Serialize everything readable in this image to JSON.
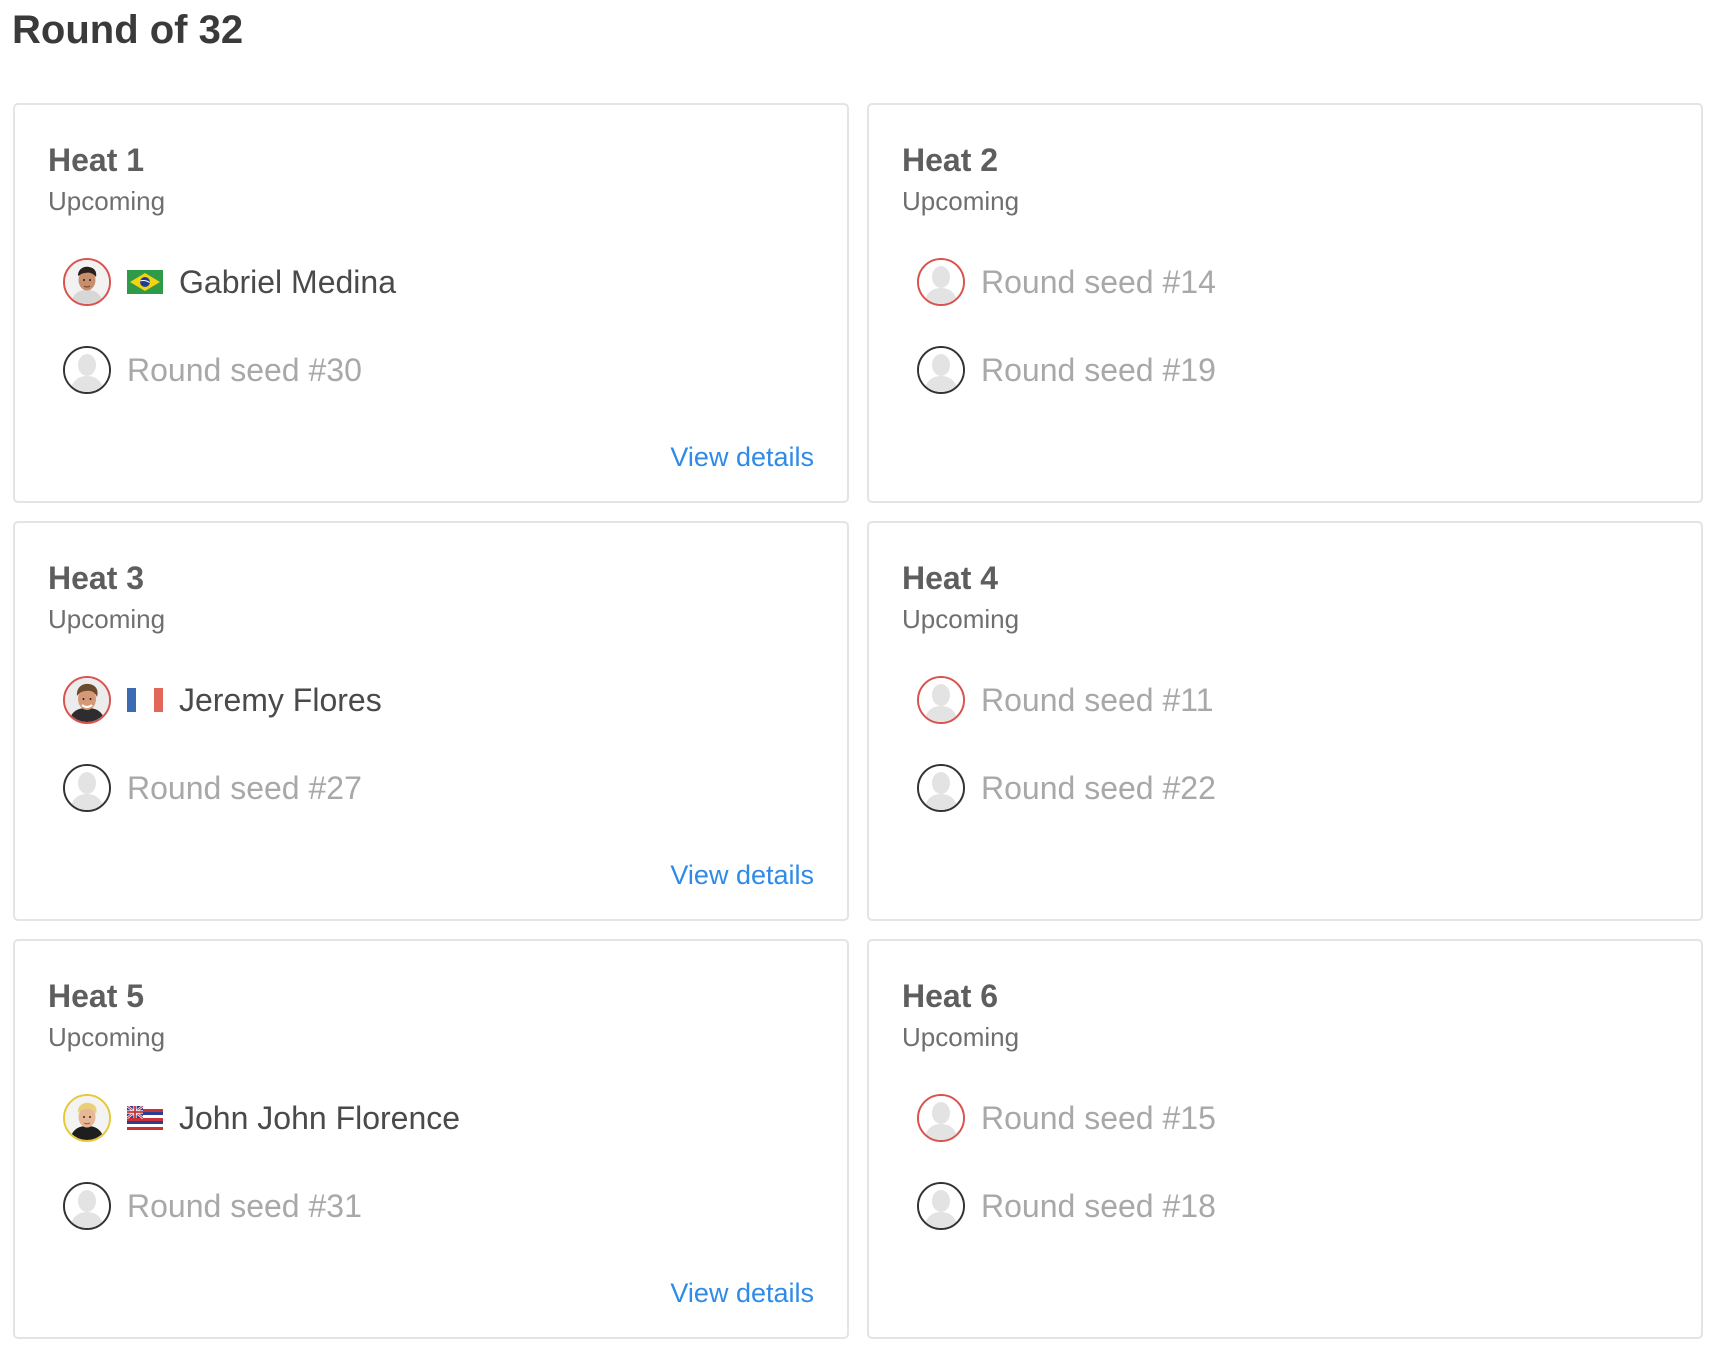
{
  "page": {
    "title": "Round of 32"
  },
  "colors": {
    "accent_link": "#2f8ae8",
    "ring_red": "#d9534f",
    "ring_dark": "#333333",
    "ring_gold": "#e5c93a"
  },
  "heats": [
    {
      "title": "Heat 1",
      "status": "Upcoming",
      "athletes": [
        {
          "name": "Gabriel Medina",
          "flag": "brazil-flag-icon",
          "ring": "#d9534f",
          "kind": "surfer"
        },
        {
          "name": "Round seed #30",
          "flag": null,
          "ring": "#333333",
          "kind": "seed"
        }
      ],
      "link": "View details"
    },
    {
      "title": "Heat 2",
      "status": "Upcoming",
      "athletes": [
        {
          "name": "Round seed #14",
          "flag": null,
          "ring": "#d9534f",
          "kind": "seed"
        },
        {
          "name": "Round seed #19",
          "flag": null,
          "ring": "#333333",
          "kind": "seed"
        }
      ],
      "link": null
    },
    {
      "title": "Heat 3",
      "status": "Upcoming",
      "athletes": [
        {
          "name": "Jeremy Flores",
          "flag": "france-flag-icon",
          "ring": "#d9534f",
          "kind": "surfer"
        },
        {
          "name": "Round seed #27",
          "flag": null,
          "ring": "#333333",
          "kind": "seed"
        }
      ],
      "link": "View details"
    },
    {
      "title": "Heat 4",
      "status": "Upcoming",
      "athletes": [
        {
          "name": "Round seed #11",
          "flag": null,
          "ring": "#d9534f",
          "kind": "seed"
        },
        {
          "name": "Round seed #22",
          "flag": null,
          "ring": "#333333",
          "kind": "seed"
        }
      ],
      "link": null
    },
    {
      "title": "Heat 5",
      "status": "Upcoming",
      "athletes": [
        {
          "name": "John John Florence",
          "flag": "hawaii-flag-icon",
          "ring": "#e5c93a",
          "kind": "surfer"
        },
        {
          "name": "Round seed #31",
          "flag": null,
          "ring": "#333333",
          "kind": "seed"
        }
      ],
      "link": "View details"
    },
    {
      "title": "Heat 6",
      "status": "Upcoming",
      "athletes": [
        {
          "name": "Round seed #15",
          "flag": null,
          "ring": "#d9534f",
          "kind": "seed"
        },
        {
          "name": "Round seed #18",
          "flag": null,
          "ring": "#333333",
          "kind": "seed"
        }
      ],
      "link": null
    }
  ]
}
